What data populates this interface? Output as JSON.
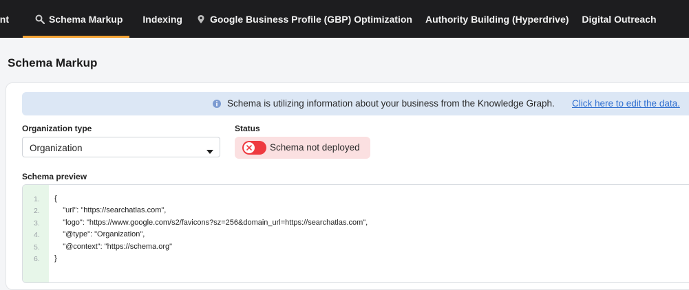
{
  "nav": {
    "tabs": [
      {
        "label": "ent",
        "icon": ""
      },
      {
        "label": "Schema Markup",
        "icon": "search-icon",
        "active": true
      },
      {
        "label": "Indexing",
        "icon": ""
      },
      {
        "label": "Google Business Profile (GBP) Optimization",
        "icon": "map-pin-icon"
      },
      {
        "label": "Authority Building (Hyperdrive)",
        "icon": ""
      },
      {
        "label": "Digital Outreach",
        "icon": ""
      }
    ],
    "active_color": "#f3a233"
  },
  "page": {
    "title": "Schema Markup"
  },
  "banner": {
    "icon": "info-icon",
    "message": "Schema is utilizing information about your business from the Knowledge Graph.",
    "link": "Click here to edit the data."
  },
  "org_type": {
    "label": "Organization type",
    "value": "Organization"
  },
  "status": {
    "label": "Status",
    "text": "Schema not deployed",
    "deployed": false,
    "color": "#ee3a40"
  },
  "preview": {
    "label": "Schema preview",
    "line_numbers": [
      "1.",
      "2.",
      "3.",
      "4.",
      "5.",
      "6."
    ],
    "lines": [
      "{",
      "    \"url\": \"https://searchatlas.com\",",
      "    \"logo\": \"https://www.google.com/s2/favicons?sz=256&domain_url=https://searchatlas.com\",",
      "    \"@type\": \"Organization\",",
      "    \"@context\": \"https://schema.org\"",
      "}"
    ]
  }
}
